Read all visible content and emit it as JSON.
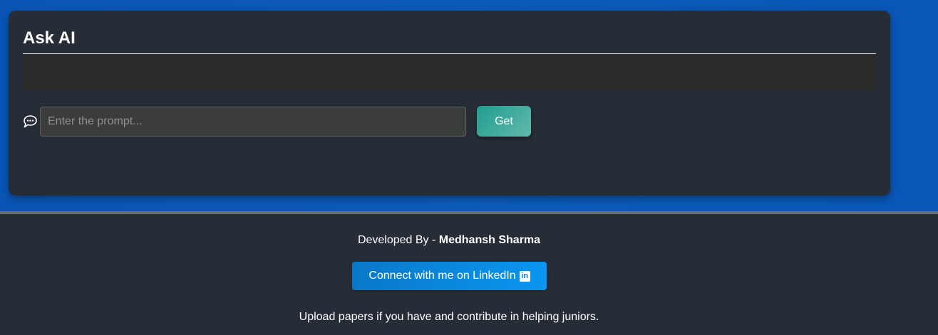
{
  "colors": {
    "background_blue": "#0a55b4",
    "panel": "#272d36",
    "accent_teal": "#1f9e8f",
    "linkedin_blue": "#0a86dc"
  },
  "ask_ai": {
    "title": "Ask AI",
    "chat_icon": "chat-bubble-icon",
    "prompt": {
      "value": "",
      "placeholder": "Enter the prompt..."
    },
    "get_label": "Get"
  },
  "footer": {
    "developed_by_label": "Developed By - ",
    "developer_name": "Medhansh Sharma",
    "linkedin_label": "Connect with me on LinkedIn",
    "linkedin_icon": "linkedin-icon",
    "linkedin_icon_text": "in",
    "upload_text": "Upload papers if you have and contribute in helping juniors."
  }
}
